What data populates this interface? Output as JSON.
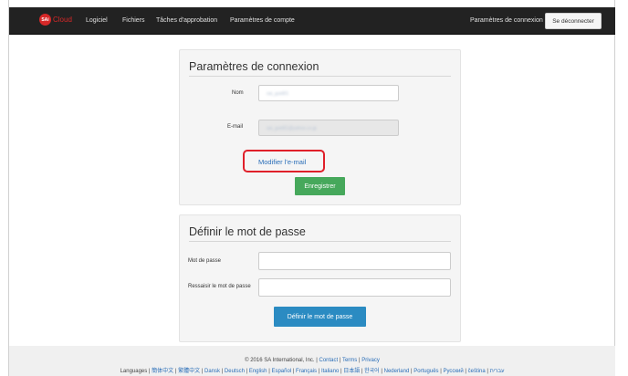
{
  "navbar": {
    "brand_logo": "SAi",
    "brand_cloud": "Cloud",
    "items": [
      "Logiciel",
      "Fichiers",
      "Tâches d'approbation",
      "Paramètres de compte"
    ],
    "right_link": "Paramètres de connexion",
    "logout": "Se déconnecter"
  },
  "connection_panel": {
    "title": "Paramètres de connexion",
    "name_label": "Nom",
    "name_value": "sai_guid01",
    "email_label": "E-mail",
    "email_value": "sai_guid01@yahoo.co.jp",
    "modify_email": "Modifier l'e-mail",
    "save": "Enregistrer"
  },
  "password_panel": {
    "title": "Définir le mot de passe",
    "password_label": "Mot de passe",
    "confirm_label": "Ressaisir le mot de passe",
    "submit": "Définir le mot de passe"
  },
  "footer": {
    "copyright": "© 2016 SA International, Inc. |",
    "links": [
      "Contact",
      "Terms",
      "Privacy"
    ],
    "languages_label": "Languages |",
    "languages": [
      "簡体中文",
      "繁體中文",
      "Dansk",
      "Deutsch",
      "English",
      "Español",
      "Français",
      "Italiano",
      "日本語",
      "한국어",
      "Nederland",
      "Português",
      "Русский",
      "čeština",
      "עברית"
    ]
  },
  "colors": {
    "navbar_bg": "#222222",
    "save_button": "#46a85b",
    "submit_button": "#2b8bc2",
    "highlight": "#e0202a",
    "link": "#2a6eb8"
  }
}
